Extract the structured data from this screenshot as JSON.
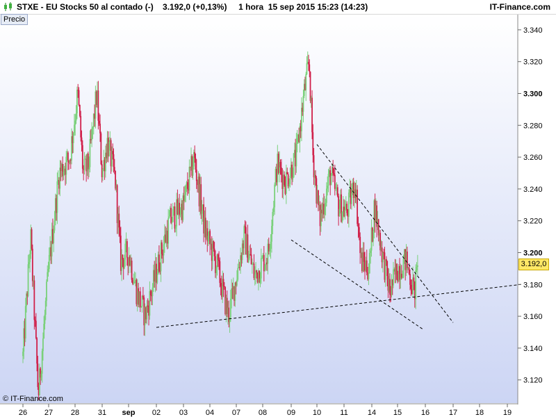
{
  "header": {
    "title": "STXE - EU Stocks 50 al contado (-)    3.192,0 (+0,13%)     1 hora  15 sep 2015 15:23 (14:23)",
    "brand": "IT-Finance.com",
    "icon": "candlestick-chart-icon"
  },
  "panel_label": "Precio",
  "copyright": "© IT-Finance.com",
  "last_price_label": "3.192,0",
  "colors": {
    "background_top": "#ffffff",
    "background_bottom": "#ccd5f4",
    "up_candle": "#7ad07a",
    "down_candle": "#d0204a",
    "trendline": "#000000",
    "price_tag": "#ffe866"
  },
  "chart_data": {
    "type": "candlestick",
    "title": "STXE - EU Stocks 50 al contado (-)",
    "interval": "1 hora",
    "y_range": [
      3105,
      3350
    ],
    "y_ticks": [
      3120,
      3140,
      3160,
      3180,
      3200,
      3220,
      3240,
      3260,
      3280,
      3300,
      3320,
      3340
    ],
    "y_tick_labels": [
      "3.120",
      "3.140",
      "3.160",
      "3.180",
      "3.200",
      "3.220",
      "3.240",
      "3.260",
      "3.280",
      "3.300",
      "3.320",
      "3.340"
    ],
    "y_bold_ticks": [
      3200,
      3300
    ],
    "x_labels": [
      "26",
      "27",
      "28",
      "31",
      "sep",
      "02",
      "03",
      "04",
      "07",
      "08",
      "09",
      "10",
      "11",
      "14",
      "15",
      "16",
      "17",
      "18",
      "19"
    ],
    "x_bold_labels": [
      "sep"
    ],
    "last_price": 3192,
    "series_anchors": [
      {
        "x": 0,
        "y": 3135
      },
      {
        "x": 0.3,
        "y": 3210
      },
      {
        "x": 0.6,
        "y": 3110
      },
      {
        "x": 1.0,
        "y": 3190
      },
      {
        "x": 1.4,
        "y": 3250
      },
      {
        "x": 1.8,
        "y": 3260
      },
      {
        "x": 2.1,
        "y": 3300
      },
      {
        "x": 2.3,
        "y": 3250
      },
      {
        "x": 2.5,
        "y": 3255
      },
      {
        "x": 2.8,
        "y": 3300
      },
      {
        "x": 3.0,
        "y": 3250
      },
      {
        "x": 3.2,
        "y": 3270
      },
      {
        "x": 3.5,
        "y": 3245
      },
      {
        "x": 3.7,
        "y": 3195
      },
      {
        "x": 4.0,
        "y": 3200
      },
      {
        "x": 4.3,
        "y": 3175
      },
      {
        "x": 4.6,
        "y": 3160
      },
      {
        "x": 5.1,
        "y": 3195
      },
      {
        "x": 5.5,
        "y": 3220
      },
      {
        "x": 6.0,
        "y": 3230
      },
      {
        "x": 6.4,
        "y": 3260
      },
      {
        "x": 6.8,
        "y": 3215
      },
      {
        "x": 7.3,
        "y": 3190
      },
      {
        "x": 7.7,
        "y": 3160
      },
      {
        "x": 8.3,
        "y": 3210
      },
      {
        "x": 8.7,
        "y": 3185
      },
      {
        "x": 9.2,
        "y": 3200
      },
      {
        "x": 9.5,
        "y": 3255
      },
      {
        "x": 9.8,
        "y": 3245
      },
      {
        "x": 10.2,
        "y": 3260
      },
      {
        "x": 10.5,
        "y": 3300
      },
      {
        "x": 10.7,
        "y": 3320
      },
      {
        "x": 10.85,
        "y": 3260
      },
      {
        "x": 11.1,
        "y": 3220
      },
      {
        "x": 11.5,
        "y": 3250
      },
      {
        "x": 11.8,
        "y": 3230
      },
      {
        "x": 12.1,
        "y": 3225
      },
      {
        "x": 12.4,
        "y": 3245
      },
      {
        "x": 12.6,
        "y": 3195
      },
      {
        "x": 12.9,
        "y": 3190
      },
      {
        "x": 13.1,
        "y": 3230
      },
      {
        "x": 13.4,
        "y": 3200
      },
      {
        "x": 13.7,
        "y": 3175
      },
      {
        "x": 14.0,
        "y": 3190
      },
      {
        "x": 14.3,
        "y": 3195
      },
      {
        "x": 14.6,
        "y": 3175
      },
      {
        "x": 14.75,
        "y": 3192
      }
    ],
    "trendlines": [
      {
        "name": "upper-channel",
        "from": {
          "x": 11.0,
          "y": 3268
        },
        "to": {
          "x": 16.0,
          "y": 3156
        }
      },
      {
        "name": "lower-channel",
        "from": {
          "x": 10.0,
          "y": 3208
        },
        "to": {
          "x": 14.9,
          "y": 3152
        }
      },
      {
        "name": "support",
        "from": {
          "x": 5.0,
          "y": 3153
        },
        "to": {
          "x": 18.5,
          "y": 3180
        }
      }
    ]
  }
}
